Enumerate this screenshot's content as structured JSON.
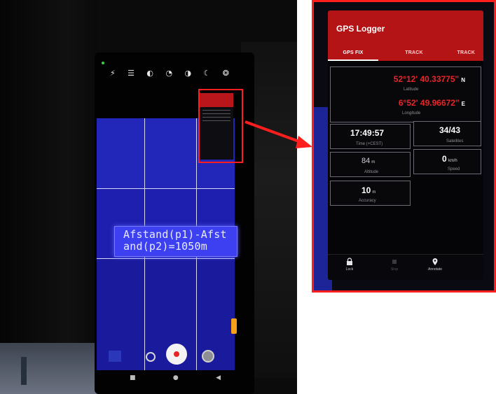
{
  "lcd": {
    "line1": "Afstand(p1)-Afst",
    "line2": "and(p2)=1050m"
  },
  "gps_logger": {
    "title": "GPS Logger",
    "tabs": [
      "GPS FIX",
      "TRACK",
      "TRACK"
    ],
    "latitude": {
      "value": "52°12' 40.33775\"",
      "dir": "N",
      "label": "Latitude"
    },
    "longitude": {
      "value": "6°52' 49.96672\"",
      "dir": "E",
      "label": "Longitude"
    },
    "time": {
      "value": "17:49:57",
      "label": "Time (+CEST)"
    },
    "satellites": {
      "value": "34/43",
      "label": "Satellites"
    },
    "altitude": {
      "value": "84",
      "unit": "m",
      "label": "Altitude"
    },
    "speed": {
      "value": "0",
      "unit": "km/h",
      "label": "Speed"
    },
    "accuracy": {
      "value": "10",
      "unit": "m",
      "label": "Accuracy"
    },
    "bottom_nav": {
      "lock": "Lock",
      "stop": "Stop",
      "annotate": "Annotate"
    }
  },
  "colors": {
    "highlight": "#ff1e1e",
    "app_header": "#b51417",
    "coord_text": "#e8262a",
    "lcd_bg": "#3d40f0"
  }
}
